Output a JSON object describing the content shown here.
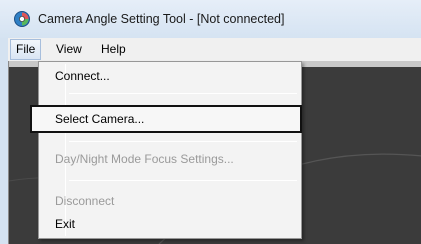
{
  "window": {
    "title": "Camera Angle Setting Tool - [Not connected]",
    "icon": "camera-app-icon"
  },
  "menubar": {
    "items": [
      {
        "label": "File",
        "active": true
      },
      {
        "label": "View",
        "active": false
      },
      {
        "label": "Help",
        "active": false
      }
    ]
  },
  "file_menu": {
    "items": [
      {
        "label": "Connect...",
        "enabled": true
      },
      {
        "label": "Select Camera...",
        "enabled": true,
        "focused": true
      },
      {
        "label": "Day/Night Mode Focus Settings...",
        "enabled": false
      },
      {
        "label": "Disconnect",
        "enabled": false
      },
      {
        "label": "Exit",
        "enabled": true
      }
    ]
  },
  "colors": {
    "title_bar": "#d5e3f2",
    "menu_background": "#f3f3f3",
    "disabled_text": "#9a9a9a",
    "content_background": "#3b3b3b"
  }
}
